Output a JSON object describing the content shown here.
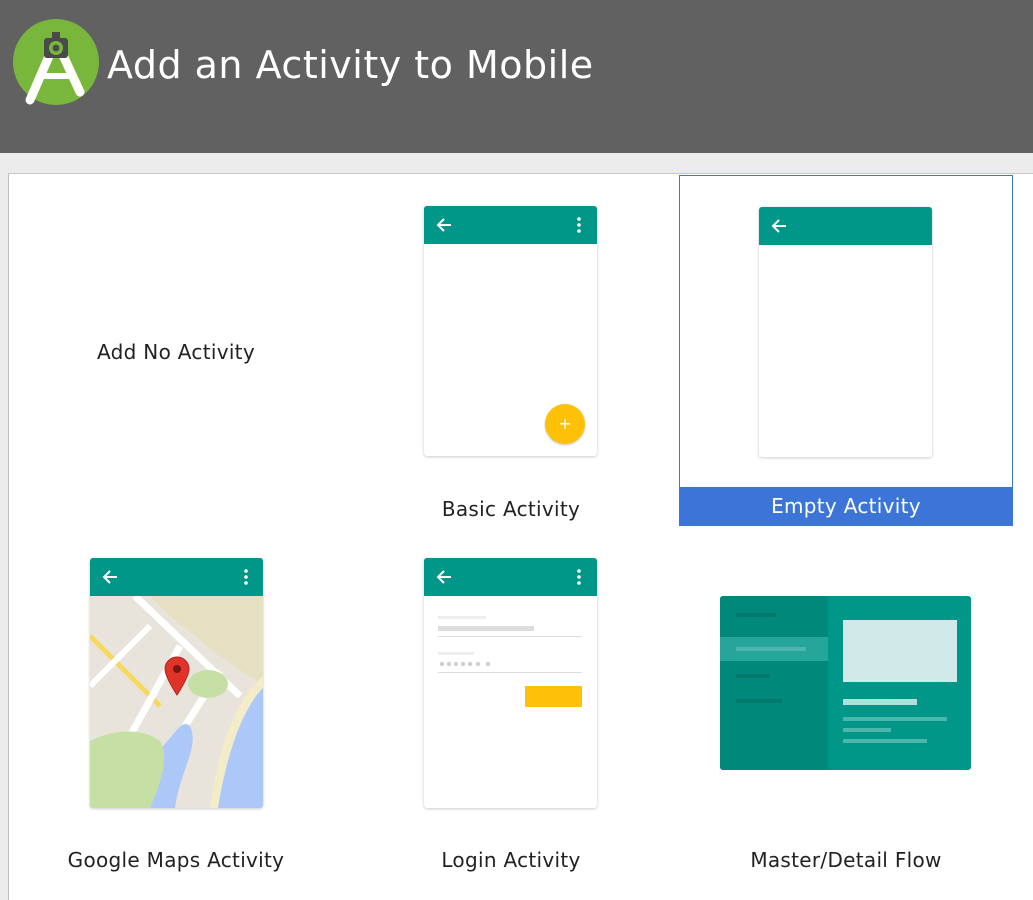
{
  "window": {
    "title": "Add an Activity to Mobile",
    "logo": "android-studio-logo-icon"
  },
  "colors": {
    "header_bg": "#616161",
    "selection": "#3c74d8",
    "appbar": "#009688",
    "accent": "#ffc107"
  },
  "activities": [
    {
      "label": "Add No Activity",
      "selected": false
    },
    {
      "label": "Basic Activity",
      "selected": false
    },
    {
      "label": "Empty Activity",
      "selected": true
    },
    {
      "label": "Google Maps Activity",
      "selected": false
    },
    {
      "label": "Login Activity",
      "selected": false
    },
    {
      "label": "Master/Detail Flow",
      "selected": false
    }
  ],
  "icons": {
    "back": "arrow-back-icon",
    "overflow": "more-vert-icon",
    "fab": "add-icon",
    "map_pin": "map-pin-icon"
  }
}
